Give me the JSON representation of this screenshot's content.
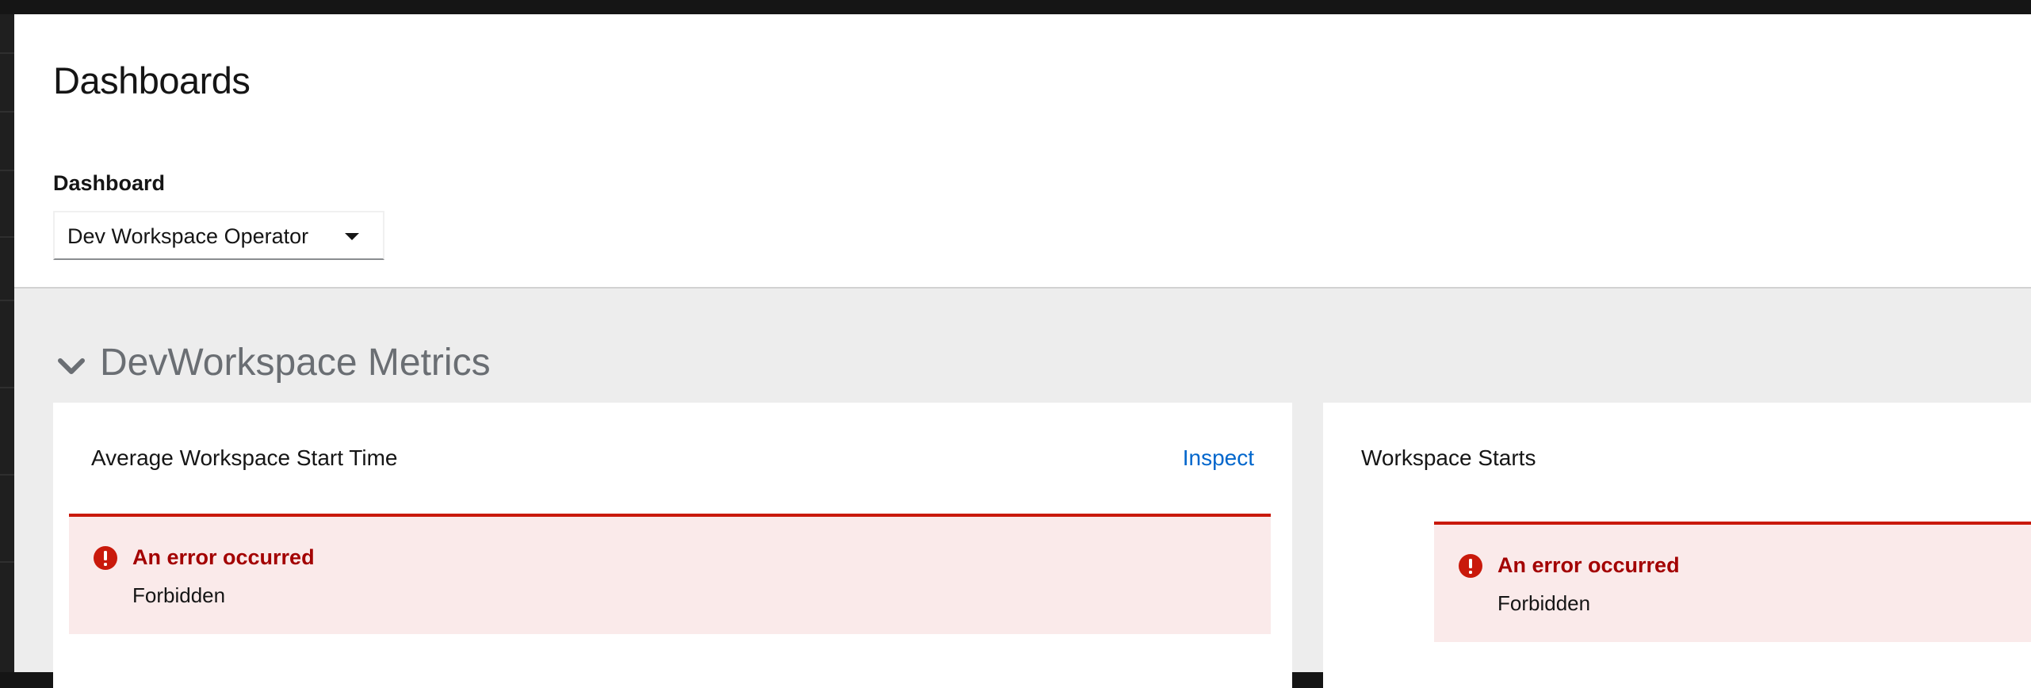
{
  "page": {
    "title": "Dashboards"
  },
  "dashboard_selector": {
    "label": "Dashboard",
    "selected": "Dev Workspace Operator"
  },
  "section": {
    "title": "DevWorkspace Metrics",
    "expanded": true
  },
  "cards": [
    {
      "title": "Average Workspace Start Time",
      "action_label": "Inspect",
      "alert": {
        "title": "An error occurred",
        "message": "Forbidden"
      }
    },
    {
      "title": "Workspace Starts",
      "alert": {
        "title": "An error occurred",
        "message": "Forbidden"
      }
    }
  ],
  "colors": {
    "danger": "#c9190b",
    "danger_text": "#a30000",
    "danger_bg": "#faeaea",
    "link": "#0066cc",
    "content_bg": "#ededed"
  },
  "icons": {
    "section_toggle": "chevron-down-icon",
    "select_caret": "caret-down-icon",
    "alert": "exclamation-circle-icon"
  }
}
